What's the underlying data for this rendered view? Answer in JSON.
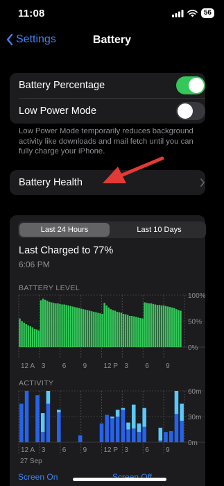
{
  "status": {
    "time": "11:08",
    "battery": "56"
  },
  "nav": {
    "back_label": "Settings",
    "title": "Battery"
  },
  "settings": {
    "battery_percentage": {
      "label": "Battery Percentage",
      "on": true
    },
    "low_power_mode": {
      "label": "Low Power Mode",
      "on": false
    },
    "footnote": "Low Power Mode temporarily reduces background activity like downloads and mail fetch until you can fully charge your iPhone.",
    "battery_health_label": "Battery Health"
  },
  "usage": {
    "tabs": [
      {
        "label": "Last 24 Hours",
        "active": true
      },
      {
        "label": "Last 10 Days",
        "active": false
      }
    ],
    "last_charged": "Last Charged to 77%",
    "charged_time": "6:06 PM"
  },
  "colors": {
    "accent": "#3b82f6",
    "toggle_on": "#34c759",
    "battery_green": "#34c759",
    "activity_on": "#2563eb",
    "activity_off": "#5ac8fa",
    "arrow": "#e53935"
  },
  "chart_data": [
    {
      "type": "bar",
      "title": "BATTERY LEVEL",
      "yticks": [
        "100%",
        "50%",
        "0%"
      ],
      "ylim": [
        0,
        100
      ],
      "xticks": [
        "12 A",
        "3",
        "6",
        "9",
        "12 P",
        "3",
        "6",
        "9"
      ],
      "values": [
        55,
        50,
        47,
        44,
        42,
        40,
        38,
        35,
        34,
        32,
        90,
        93,
        91,
        89,
        87,
        86,
        85,
        84,
        84,
        83,
        82,
        82,
        81,
        80,
        79,
        78,
        77,
        76,
        75,
        74,
        73,
        72,
        71,
        70,
        69,
        68,
        67,
        66,
        65,
        64,
        85,
        80,
        76,
        73,
        71,
        70,
        68,
        67,
        66,
        64,
        63,
        62,
        60,
        60,
        59,
        58,
        57,
        56,
        55,
        86,
        85,
        84,
        84,
        83,
        82,
        81,
        81,
        80,
        80,
        79,
        78,
        77,
        76,
        75,
        73,
        71,
        70
      ]
    },
    {
      "type": "bar",
      "title": "ACTIVITY",
      "yticks": [
        "60m",
        "30m",
        "0m"
      ],
      "ylim": [
        0,
        60
      ],
      "xticks": [
        "12 A",
        "3",
        "6",
        "9",
        "12 P",
        "3",
        "6",
        "9"
      ],
      "date_label": "27 Sep",
      "series": [
        {
          "name": "Screen On",
          "values": [
            45,
            60,
            0,
            55,
            12,
            45,
            0,
            35,
            0,
            0,
            0,
            8,
            0,
            0,
            0,
            22,
            32,
            28,
            30,
            38,
            15,
            16,
            12,
            18,
            0,
            0,
            2,
            12,
            13,
            33,
            25
          ]
        },
        {
          "name": "Screen Off",
          "values": [
            0,
            0,
            0,
            0,
            22,
            15,
            0,
            3,
            0,
            0,
            0,
            0,
            0,
            0,
            0,
            0,
            0,
            2,
            8,
            2,
            8,
            28,
            10,
            22,
            0,
            0,
            15,
            0,
            0,
            27,
            20
          ]
        }
      ]
    }
  ],
  "legend": {
    "screen_on": "Screen On",
    "screen_off": "Screen Off"
  }
}
